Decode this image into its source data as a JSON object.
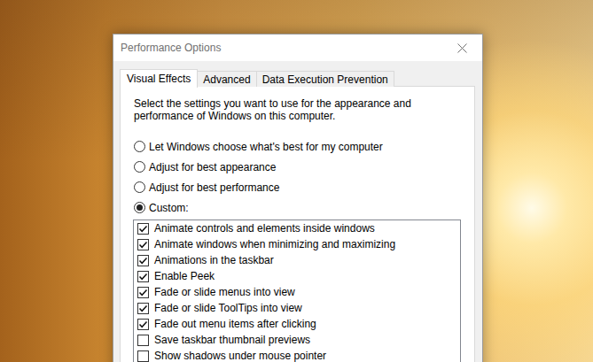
{
  "window": {
    "title": "Performance Options"
  },
  "tabs": [
    {
      "label": "Visual Effects",
      "selected": true
    },
    {
      "label": "Advanced",
      "selected": false
    },
    {
      "label": "Data Execution Prevention",
      "selected": false
    }
  ],
  "description": "Select the settings you want to use for the appearance and performance of Windows on this computer.",
  "options": [
    {
      "label": "Let Windows choose what's best for my computer",
      "selected": false
    },
    {
      "label": "Adjust for best appearance",
      "selected": false
    },
    {
      "label": "Adjust for best performance",
      "selected": false
    },
    {
      "label": "Custom:",
      "selected": true
    }
  ],
  "effects": [
    {
      "label": "Animate controls and elements inside windows",
      "checked": true
    },
    {
      "label": "Animate windows when minimizing and maximizing",
      "checked": true
    },
    {
      "label": "Animations in the taskbar",
      "checked": true
    },
    {
      "label": "Enable Peek",
      "checked": true
    },
    {
      "label": "Fade or slide menus into view",
      "checked": true
    },
    {
      "label": "Fade or slide ToolTips into view",
      "checked": true
    },
    {
      "label": "Fade out menu items after clicking",
      "checked": true
    },
    {
      "label": "Save taskbar thumbnail previews",
      "checked": false
    },
    {
      "label": "Show shadows under mouse pointer",
      "checked": false
    }
  ]
}
